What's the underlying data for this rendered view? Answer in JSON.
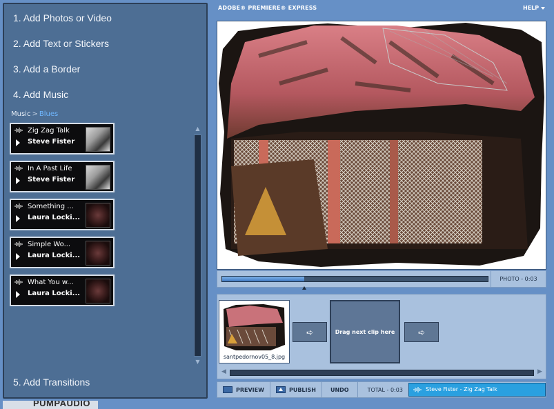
{
  "header": {
    "app_title": "ADOBE® PREMIERE® EXPRESS",
    "help": "HELP"
  },
  "steps": [
    {
      "label": "1.  Add Photos or Video"
    },
    {
      "label": "2.  Add Text or Stickers"
    },
    {
      "label": "3.  Add a Border"
    },
    {
      "label": "4.  Add Music"
    },
    {
      "label": "5.  Add Transitions"
    }
  ],
  "music": {
    "breadcrumb_root": "Music",
    "breadcrumb_sep": ">",
    "breadcrumb_genre": "Blues",
    "tracks": [
      {
        "title": "Zig Zag Talk",
        "artist": "Steve Fister",
        "thumb": "bw"
      },
      {
        "title": "In A Past Life",
        "artist": "Steve Fister",
        "thumb": "bw"
      },
      {
        "title": "Something ...",
        "artist": "Laura Locki...",
        "thumb": "dark"
      },
      {
        "title": "Simple Wo...",
        "artist": "Laura Locki...",
        "thumb": "dark"
      },
      {
        "title": "What You w...",
        "artist": "Laura Locki...",
        "thumb": "dark"
      }
    ]
  },
  "timeline": {
    "progress_fraction": 0.31,
    "clip_label": "PHOTO - 0:03"
  },
  "storyboard": {
    "clip_name": "santpedornov05_8.jpg",
    "drop_label": "Drag next clip here",
    "arrow": "➪"
  },
  "toolbar": {
    "preview": "PREVIEW",
    "publish": "PUBLISH",
    "undo": "UNDO",
    "total": "TOTAL - 0:03",
    "audio_track": "Steve Fister - Zig Zag Talk"
  },
  "footer": {
    "logo_text": "PUMPAUDIO"
  },
  "colors": {
    "background": "#6690c6",
    "panel": "#4d6e94",
    "accent": "#2aa0e0"
  }
}
